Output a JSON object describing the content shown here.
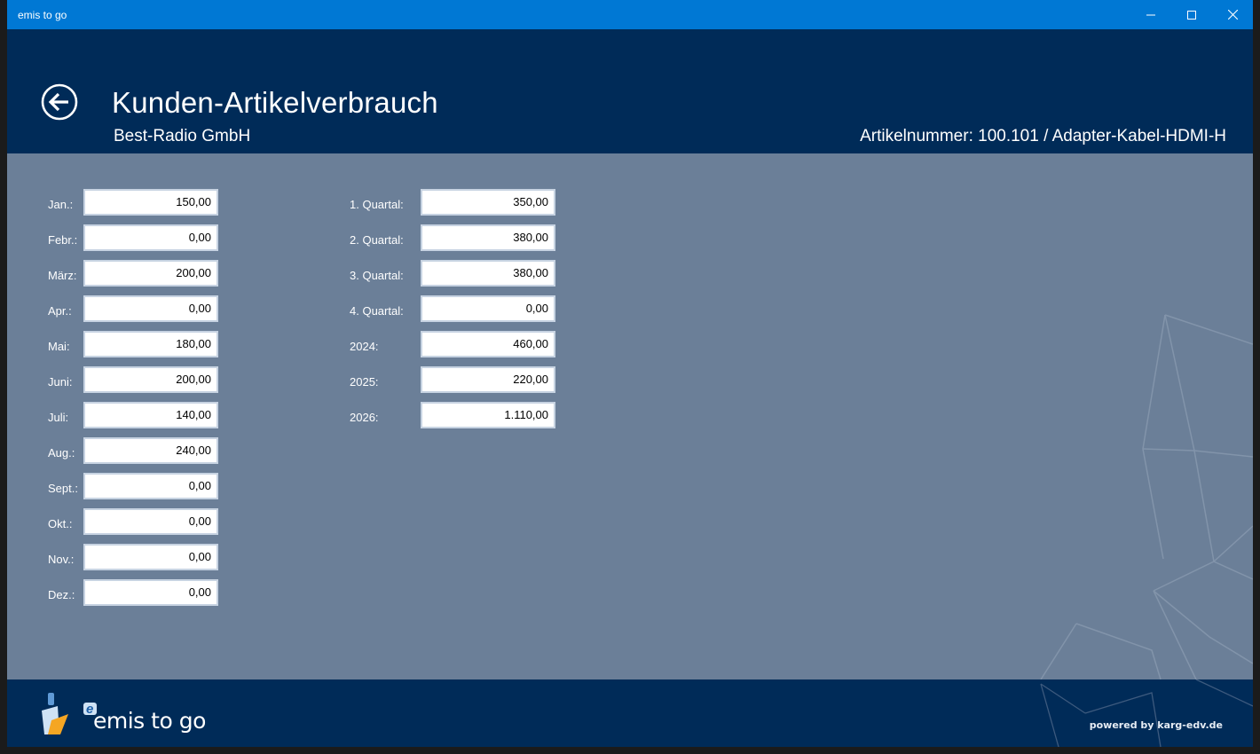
{
  "window": {
    "title": "emis to go"
  },
  "header": {
    "title": "Kunden-Artikelverbrauch",
    "customer": "Best-Radio GmbH",
    "article": "Artikelnummer: 100.101 / Adapter-Kabel-HDMI-H"
  },
  "months": [
    {
      "label": "Jan.:",
      "value": "150,00"
    },
    {
      "label": "Febr.:",
      "value": "0,00"
    },
    {
      "label": "März:",
      "value": "200,00"
    },
    {
      "label": "Apr.:",
      "value": "0,00"
    },
    {
      "label": "Mai:",
      "value": "180,00"
    },
    {
      "label": "Juni:",
      "value": "200,00"
    },
    {
      "label": "Juli:",
      "value": "140,00"
    },
    {
      "label": "Aug.:",
      "value": "240,00"
    },
    {
      "label": "Sept.:",
      "value": "0,00"
    },
    {
      "label": "Okt.:",
      "value": "0,00"
    },
    {
      "label": "Nov.:",
      "value": "0,00"
    },
    {
      "label": "Dez.:",
      "value": "0,00"
    }
  ],
  "summary": [
    {
      "label": "1. Quartal:",
      "value": "350,00"
    },
    {
      "label": "2. Quartal:",
      "value": "380,00"
    },
    {
      "label": "3. Quartal:",
      "value": "380,00"
    },
    {
      "label": "4. Quartal:",
      "value": "0,00"
    },
    {
      "label": "2024:",
      "value": "460,00"
    },
    {
      "label": "2025:",
      "value": "220,00"
    },
    {
      "label": "2026:",
      "value": "1.110,00"
    }
  ],
  "footer": {
    "logo_badge": "e",
    "logo_text": "emis to go",
    "powered_by": "powered by karg-edv.de"
  },
  "colors": {
    "titlebar": "#0078d4",
    "header": "#002b58",
    "content": "#6b7f98",
    "accent_orange": "#f5a623"
  }
}
